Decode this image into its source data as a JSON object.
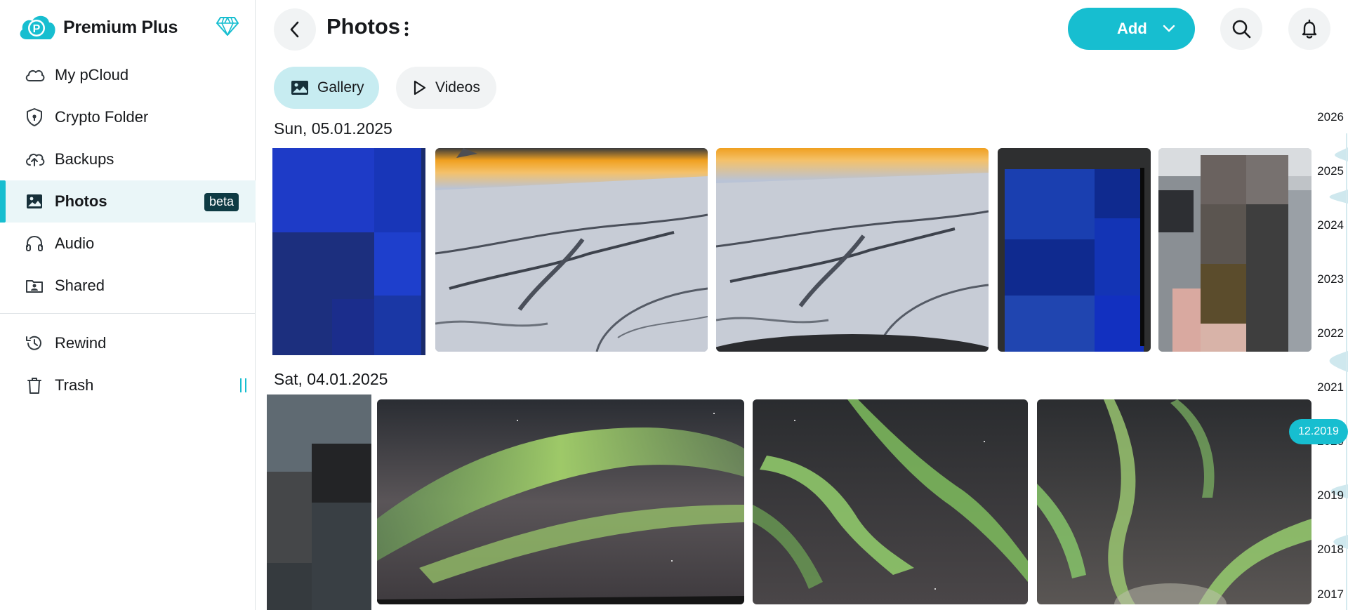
{
  "app": {
    "plan_name": "Premium Plus",
    "brand_color": "#17bed0",
    "icons": [
      "pcloud-logo-icon",
      "diamond-icon"
    ]
  },
  "sidebar": {
    "items": [
      {
        "label": "My pCloud",
        "icon": "cloud-icon"
      },
      {
        "label": "Crypto Folder",
        "icon": "shield-lock-icon"
      },
      {
        "label": "Backups",
        "icon": "cloud-upload-icon"
      },
      {
        "label": "Photos",
        "icon": "image-icon",
        "active": true,
        "badge": "beta"
      },
      {
        "label": "Audio",
        "icon": "headphones-icon"
      },
      {
        "label": "Shared",
        "icon": "shared-folder-icon"
      }
    ],
    "secondary_items": [
      {
        "label": "Rewind",
        "icon": "history-icon"
      },
      {
        "label": "Trash",
        "icon": "trash-icon"
      }
    ]
  },
  "header": {
    "title": "Photos",
    "add_label": "Add",
    "icons": [
      "back-arrow-icon",
      "kebab-menu-icon",
      "chevron-down-icon",
      "search-icon",
      "bell-icon"
    ]
  },
  "tabs": [
    {
      "label": "Gallery",
      "icon": "image-icon",
      "selected": true
    },
    {
      "label": "Videos",
      "icon": "play-icon",
      "selected": false
    }
  ],
  "groups": [
    {
      "date": "Sun, 05.01.2025",
      "photos": [
        "blurred-blue-redacted",
        "aerial-snow-sunset-1",
        "aerial-snow-sunset-2",
        "dark-blue-redacted",
        "airport-luggage-redacted"
      ]
    },
    {
      "date": "Sat, 04.01.2025",
      "photos": [
        "gray-redacted",
        "aurora-green-1",
        "aurora-green-2",
        "aurora-green-3"
      ]
    }
  ],
  "timeline": {
    "years": [
      "2026",
      "2025",
      "2024",
      "2023",
      "2022",
      "2021",
      "2020",
      "2019",
      "2018",
      "2017"
    ],
    "current": "12.2019"
  }
}
